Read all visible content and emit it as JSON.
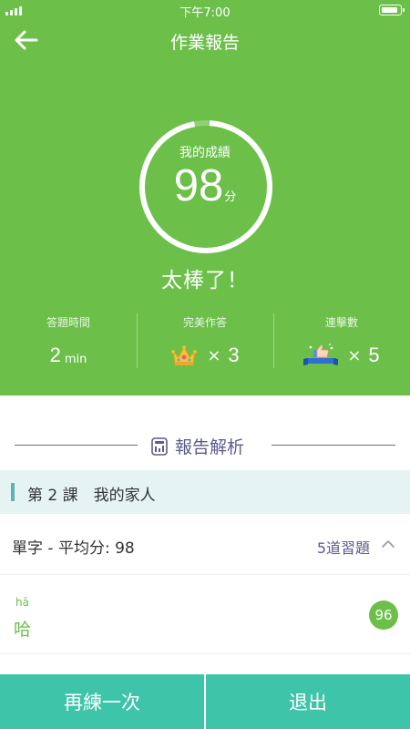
{
  "status_bar": {
    "time": "下午7:00"
  },
  "nav": {
    "title": "作業報告",
    "back_icon": "arrow-left-icon"
  },
  "score": {
    "label": "我的成績",
    "value": "98",
    "unit": "分",
    "ring_progress": 0.98,
    "praise": "太棒了！"
  },
  "stats": [
    {
      "label": "答題時間",
      "value": "2",
      "unit": "min"
    },
    {
      "label": "完美作答",
      "icon": "crown-icon",
      "times": "×",
      "value": "3"
    },
    {
      "label": "連擊數",
      "icon": "combo-thumbs-up-icon",
      "times": "×",
      "value": "5"
    }
  ],
  "report": {
    "title": "報告解析",
    "icon": "report-chart-icon"
  },
  "lesson": {
    "title": "第 2 課　我的家人"
  },
  "vocab": {
    "title": "單字 - 平均分: 98",
    "count": "5道習題",
    "toggle_icon": "chevron-up-icon"
  },
  "words": [
    {
      "pinyin": "hā",
      "hanzi": "哈",
      "score": "96"
    }
  ],
  "buttons": {
    "retry": "再練一次",
    "exit": "退出"
  },
  "colors": {
    "primary_green": "#6cc04a",
    "teal": "#3ec4a9",
    "purple": "#5d5a8c",
    "lesson_bg": "#e5f4f3"
  }
}
